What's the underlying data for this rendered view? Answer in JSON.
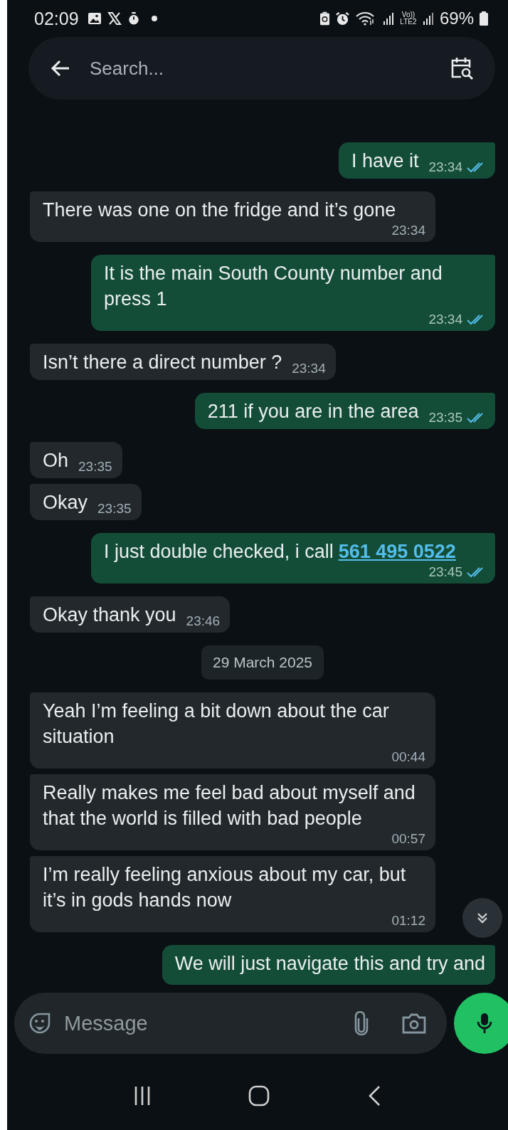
{
  "status_bar": {
    "time": "02:09",
    "network": "Vo)) LTE2",
    "battery": "69%"
  },
  "search": {
    "placeholder": "Search..."
  },
  "messages": [
    {
      "kind": "message",
      "outgoing": true,
      "text": "I have it",
      "time": "23:34",
      "read": true
    },
    {
      "kind": "message",
      "outgoing": false,
      "text": "There was one on the fridge and it’s gone",
      "time": "23:34"
    },
    {
      "kind": "message",
      "outgoing": true,
      "text": "It is the main South County number and press 1",
      "time": "23:34",
      "read": true
    },
    {
      "kind": "message",
      "outgoing": false,
      "text": "Isn’t there a direct number ?",
      "time": "23:34"
    },
    {
      "kind": "message",
      "outgoing": true,
      "text": "211 if you are in the area",
      "time": "23:35",
      "read": true
    },
    {
      "kind": "message",
      "outgoing": false,
      "text": "Oh",
      "time": "23:35"
    },
    {
      "kind": "message",
      "outgoing": false,
      "text": "Okay",
      "time": "23:35"
    },
    {
      "kind": "message",
      "outgoing": true,
      "text": "I just double checked, i call",
      "link": "561 495 0522",
      "time": "23:45",
      "read": true
    },
    {
      "kind": "message",
      "outgoing": false,
      "text": "Okay thank you",
      "time": "23:46"
    },
    {
      "kind": "date",
      "text": "29 March 2025"
    },
    {
      "kind": "message",
      "outgoing": false,
      "text": "Yeah I’m feeling a bit down about the car situation",
      "time": "00:44"
    },
    {
      "kind": "message",
      "outgoing": false,
      "text": "Really makes me feel bad about myself and that the world is filled with bad people",
      "time": "00:57"
    },
    {
      "kind": "message",
      "outgoing": false,
      "text": "I’m really feeling anxious about my car, but it’s in gods hands now",
      "time": "01:12"
    },
    {
      "kind": "partial",
      "outgoing": true,
      "text": "We will just navigate this and try and"
    }
  ],
  "composer": {
    "placeholder": "Message"
  }
}
